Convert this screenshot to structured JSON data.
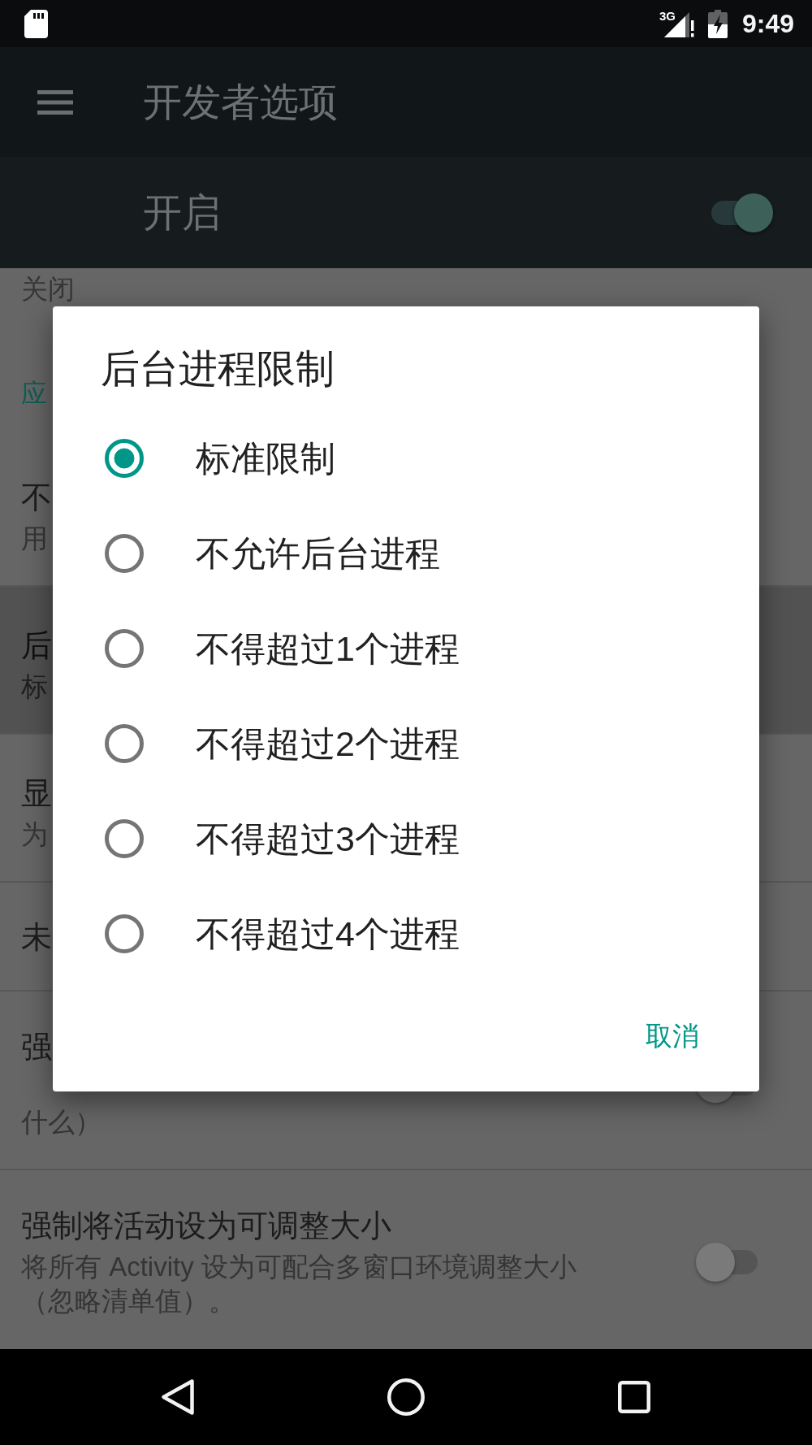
{
  "status_bar": {
    "network": "3G",
    "time": "9:49"
  },
  "toolbar": {
    "title": "开发者选项"
  },
  "master_switch": {
    "label": "开启",
    "on": true
  },
  "settings": [
    {
      "kind": "fragment",
      "summary": "关闭",
      "selected": false
    },
    {
      "kind": "header",
      "title": "应"
    },
    {
      "kind": "item",
      "title": "不",
      "summary": "用",
      "selected": false
    },
    {
      "kind": "item",
      "title": "后",
      "summary": "标",
      "selected": true
    },
    {
      "kind": "item",
      "title": "显",
      "summary": "为",
      "selected": false
    },
    {
      "kind": "item",
      "title": "未",
      "selected": false
    },
    {
      "kind": "switch",
      "title": "强",
      "summary": "什么）",
      "on": false,
      "selected": false
    },
    {
      "kind": "switch",
      "title": "强制将活动设为可调整大小",
      "summary": "将所有 Activity 设为可配合多窗口环境调整大小（忽略清单值）。",
      "on": false,
      "selected": false
    }
  ],
  "dialog": {
    "title": "后台进程限制",
    "options": [
      {
        "label": "标准限制",
        "selected": true
      },
      {
        "label": "不允许后台进程",
        "selected": false
      },
      {
        "label": "不得超过1个进程",
        "selected": false
      },
      {
        "label": "不得超过2个进程",
        "selected": false
      },
      {
        "label": "不得超过3个进程",
        "selected": false
      },
      {
        "label": "不得超过4个进程",
        "selected": false
      }
    ],
    "buttons": [
      "取消"
    ]
  }
}
